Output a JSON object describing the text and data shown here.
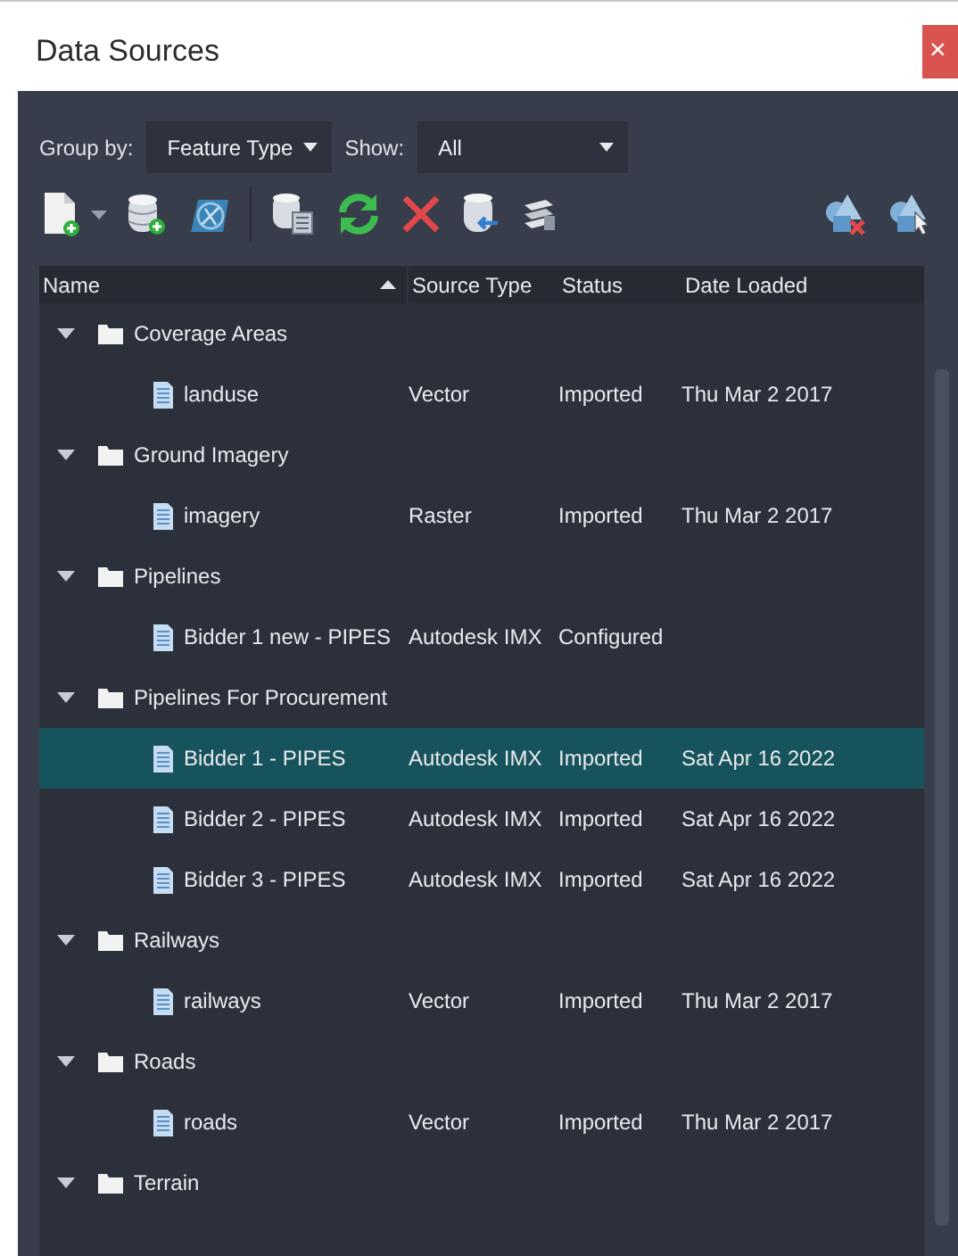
{
  "window": {
    "title": "Data Sources",
    "close": "×"
  },
  "filters": [
    {
      "label": "Group by:",
      "value": "Feature Type"
    },
    {
      "label": "Show:",
      "value": "All"
    }
  ],
  "table": {
    "columns": [
      {
        "label": "Name",
        "sorted": true
      },
      {
        "label": "Source Type",
        "sorted": false
      },
      {
        "label": "Status",
        "sorted": false
      },
      {
        "label": "Date Loaded",
        "sorted": false
      }
    ],
    "groups": [
      {
        "name": "Coverage Areas",
        "expanded": true,
        "children": [
          {
            "name": "landuse",
            "source_type": "Vector",
            "status": "Imported",
            "date": "Thu Mar 2 2017",
            "selected": false
          }
        ]
      },
      {
        "name": "Ground Imagery",
        "expanded": true,
        "children": [
          {
            "name": "imagery",
            "source_type": "Raster",
            "status": "Imported",
            "date": "Thu Mar 2 2017",
            "selected": false
          }
        ]
      },
      {
        "name": "Pipelines",
        "expanded": true,
        "children": [
          {
            "name": "Bidder 1 new - PIPES",
            "source_type": "Autodesk IMX",
            "status": "Configured",
            "selected": false
          }
        ]
      },
      {
        "name": "Pipelines For Procurement",
        "expanded": true,
        "children": [
          {
            "name": "Bidder 1 - PIPES",
            "source_type": "Autodesk IMX",
            "status": "Imported",
            "date": "Sat Apr 16 2022",
            "selected": true
          },
          {
            "name": "Bidder 2 - PIPES",
            "source_type": "Autodesk IMX",
            "status": "Imported",
            "date": "Sat Apr 16 2022",
            "selected": false
          },
          {
            "name": "Bidder 3 - PIPES",
            "source_type": "Autodesk IMX",
            "status": "Imported",
            "date": "Sat Apr 16 2022",
            "selected": false
          }
        ]
      },
      {
        "name": "Railways",
        "expanded": true,
        "children": [
          {
            "name": "railways",
            "source_type": "Vector",
            "status": "Imported",
            "date": "Thu Mar 2 2017",
            "selected": false
          }
        ]
      },
      {
        "name": "Roads",
        "expanded": true,
        "children": [
          {
            "name": "roads",
            "source_type": "Vector",
            "status": "Imported",
            "date": "Thu Mar 2 2017",
            "selected": false
          }
        ]
      },
      {
        "name": "Terrain",
        "expanded": true
      }
    ]
  }
}
